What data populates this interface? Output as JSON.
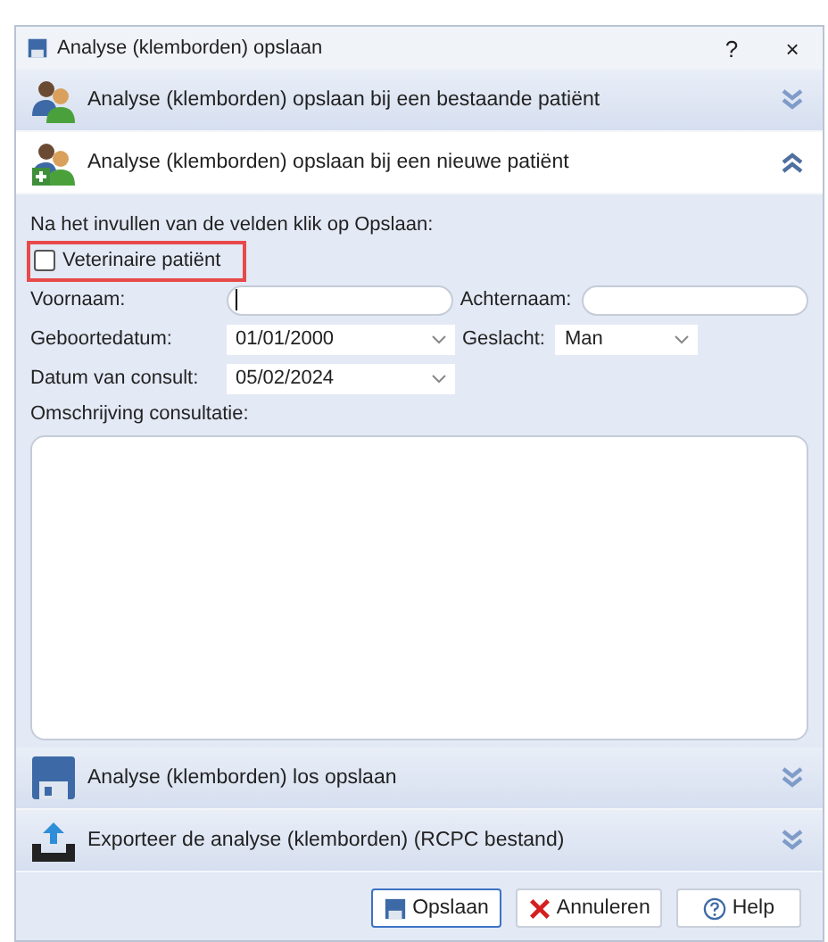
{
  "window": {
    "title": "Analyse (klemborden) opslaan",
    "help": "?",
    "close": "×"
  },
  "sections": [
    {
      "kind": "existing",
      "title": "Analyse (klemborden) opslaan bij een bestaande patiënt",
      "expanded": false
    },
    {
      "kind": "new",
      "title": "Analyse (klemborden) opslaan bij een nieuwe patiënt",
      "expanded": true
    }
  ],
  "form": {
    "instruction": "Na het invullen van de velden klik op Opslaan:",
    "checkbox": {
      "label": "Veterinaire patiënt",
      "checked": false,
      "highlighted": true
    },
    "first_name": {
      "label": "Voornaam:"
    },
    "last_name": {
      "label": "Achternaam:"
    },
    "birth_date": {
      "label": "Geboortedatum:",
      "value": "01/01/2000"
    },
    "gender": {
      "label": "Geslacht:",
      "value": "Man"
    },
    "consult_date": {
      "label": "Datum van consult:",
      "value": "05/02/2024"
    },
    "description": {
      "label": "Omschrijving consultatie:"
    }
  },
  "bottom_sections": [
    {
      "kind": "save",
      "title": "Analyse (klemborden) los opslaan",
      "expanded": false
    },
    {
      "kind": "export",
      "title": "Exporteer de analyse (klemborden) (RCPC bestand)",
      "expanded": false
    }
  ],
  "buttons": [
    {
      "kind": "save",
      "label": "Opslaan",
      "focused": true
    },
    {
      "kind": "cancel",
      "label": "Annuleren",
      "focused": false
    },
    {
      "kind": "help",
      "label": "Help",
      "focused": false
    }
  ]
}
